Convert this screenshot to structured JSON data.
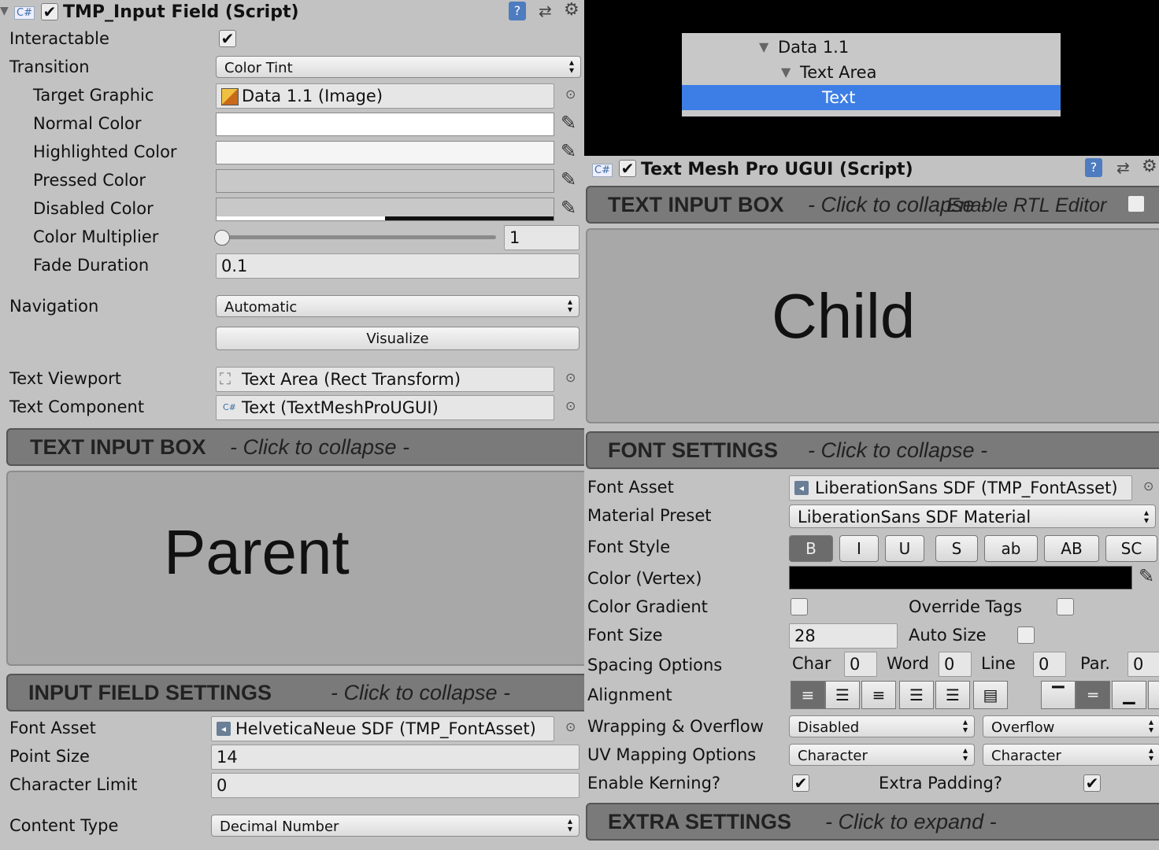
{
  "input_field": {
    "title": "TMP_Input Field (Script)",
    "rows": {
      "interactable": "Interactable",
      "transition": "Transition",
      "transition_value": "Color Tint",
      "target_graphic": "Target Graphic",
      "target_graphic_value": "Data 1.1 (Image)",
      "normal_color": "Normal Color",
      "highlighted_color": "Highlighted Color",
      "pressed_color": "Pressed Color",
      "disabled_color": "Disabled Color",
      "color_multiplier": "Color Multiplier",
      "color_multiplier_value": "1",
      "fade_duration": "Fade Duration",
      "fade_duration_value": "0.1",
      "navigation": "Navigation",
      "navigation_value": "Automatic",
      "visualize": "Visualize",
      "text_viewport": "Text Viewport",
      "text_viewport_value": "Text Area (Rect Transform)",
      "text_component": "Text Component",
      "text_component_value": "Text (TextMeshProUGUI)"
    },
    "text_input_section": {
      "title": "TEXT INPUT BOX",
      "subtitle": "- Click to collapse -"
    },
    "text_input_value": "Parent",
    "settings_section": {
      "title": "INPUT FIELD SETTINGS",
      "subtitle": "- Click to collapse -"
    },
    "settings": {
      "font_asset": "Font Asset",
      "font_asset_value": "HelveticaNeue SDF (TMP_FontAsset)",
      "point_size": "Point Size",
      "point_size_value": "14",
      "character_limit": "Character Limit",
      "character_limit_value": "0",
      "content_type": "Content Type",
      "content_type_value": "Decimal Number"
    }
  },
  "hierarchy": {
    "items": [
      "Data 1.1",
      "Text Area",
      "Text"
    ]
  },
  "tmp_ugui": {
    "title": "Text Mesh Pro UGUI (Script)",
    "text_input_section": {
      "title": "TEXT INPUT BOX",
      "subtitle": "- Click to collapse -",
      "rtl": "Enable RTL Editor"
    },
    "text_input_value": "Child",
    "font_section": {
      "title": "FONT SETTINGS",
      "subtitle": "- Click to collapse -"
    },
    "rows": {
      "font_asset": "Font Asset",
      "font_asset_value": "LiberationSans SDF (TMP_FontAsset)",
      "material_preset": "Material Preset",
      "material_preset_value": "LiberationSans SDF Material",
      "font_style": "Font Style",
      "styles": [
        "B",
        "I",
        "U",
        "S",
        "ab",
        "AB",
        "SC"
      ],
      "color_vertex": "Color (Vertex)",
      "color_gradient": "Color Gradient",
      "override_tags": "Override Tags",
      "font_size": "Font Size",
      "font_size_value": "28",
      "auto_size": "Auto Size",
      "spacing_options": "Spacing Options",
      "char": "Char",
      "char_value": "0",
      "word": "Word",
      "word_value": "0",
      "line": "Line",
      "line_value": "0",
      "par": "Par.",
      "par_value": "0",
      "alignment": "Alignment",
      "wrapping": "Wrapping & Overflow",
      "wrapping_value": "Disabled",
      "overflow_value": "Overflow",
      "uv_mapping": "UV Mapping Options",
      "uv_h_value": "Character",
      "uv_v_value": "Character",
      "enable_kerning": "Enable Kerning?",
      "extra_padding": "Extra Padding?"
    },
    "extra_section": {
      "title": "EXTRA SETTINGS",
      "subtitle": "- Click to expand -"
    }
  },
  "icons": {
    "cs_script": "C#",
    "checkmark": "✔",
    "dropdown_arrow": "▴▾",
    "eyedropper": "✎",
    "object_picker": "⊙",
    "triangle_down": "▼"
  },
  "colors": {
    "panel_bg": "#c2c2c2",
    "section_bg": "#7a7a7a",
    "selection_blue": "#3d7ee6",
    "vertex_color": "#000000"
  }
}
